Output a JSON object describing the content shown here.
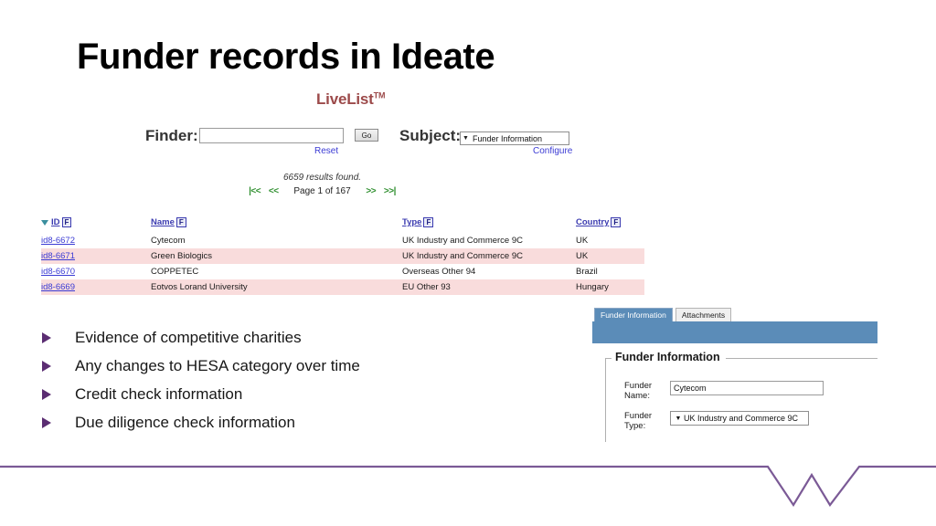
{
  "slide": {
    "title": "Funder records in Ideate"
  },
  "app": {
    "logo": "LiveList",
    "logo_tm": "TM"
  },
  "search": {
    "finder_label": "Finder:",
    "finder_value": "",
    "finder_placeholder": "",
    "go_label": "Go",
    "reset_label": "Reset",
    "subject_label": "Subject:",
    "subject_value": "Funder Information",
    "configure_label": "Configure",
    "dropdown_arrow": "▼"
  },
  "results": {
    "count_text": "6659 results found.",
    "first_label": "|<<",
    "prev_label": "<<",
    "page_text": "Page 1 of 167",
    "next_label": ">>",
    "last_label": ">>|"
  },
  "table": {
    "columns": [
      {
        "label": "ID",
        "filter": "F",
        "sorted": true
      },
      {
        "label": "Name",
        "filter": "F",
        "sorted": false
      },
      {
        "label": "Type",
        "filter": "F",
        "sorted": false
      },
      {
        "label": "Country",
        "filter": "F",
        "sorted": false
      }
    ],
    "rows": [
      {
        "id": "id8-6672",
        "name": "Cytecom",
        "type": "UK Industry and Commerce 9C",
        "country": "UK"
      },
      {
        "id": "id8-6671",
        "name": "Green Biologics",
        "type": "UK Industry and Commerce 9C",
        "country": "UK"
      },
      {
        "id": "id8-6670",
        "name": "COPPETEC",
        "type": "Overseas Other 94",
        "country": "Brazil"
      },
      {
        "id": "id8-6669",
        "name": "Eotvos Lorand University",
        "type": "EU Other 93",
        "country": "Hungary"
      }
    ]
  },
  "bullets": [
    {
      "text": "Evidence of competitive charities"
    },
    {
      "text": "Any changes to HESA category over time"
    },
    {
      "text": "Credit check information"
    },
    {
      "text": "Due diligence check information"
    }
  ],
  "detail": {
    "tabs": [
      {
        "label": "Funder Information",
        "active": true
      },
      {
        "label": "Attachments",
        "active": false
      }
    ],
    "section_title": "Funder Information",
    "fields": [
      {
        "label": "Funder Name:",
        "label_line1": "Funder",
        "label_line2": "Name:",
        "value": "Cytecom",
        "kind": "text"
      },
      {
        "label": "Funder Type:",
        "label_line1": "Funder",
        "label_line2": "Type:",
        "value": "UK Industry and Commerce 9C",
        "kind": "select"
      }
    ],
    "dropdown_arrow": "▼"
  },
  "colors": {
    "accent_purple": "#7B5A96",
    "panel_blue": "#5B8CB8",
    "row_alt": "#F9DCDC",
    "link_blue": "#3B3BD4",
    "pager_green": "#2F8F2F",
    "logo_red": "#9C4A4A"
  }
}
